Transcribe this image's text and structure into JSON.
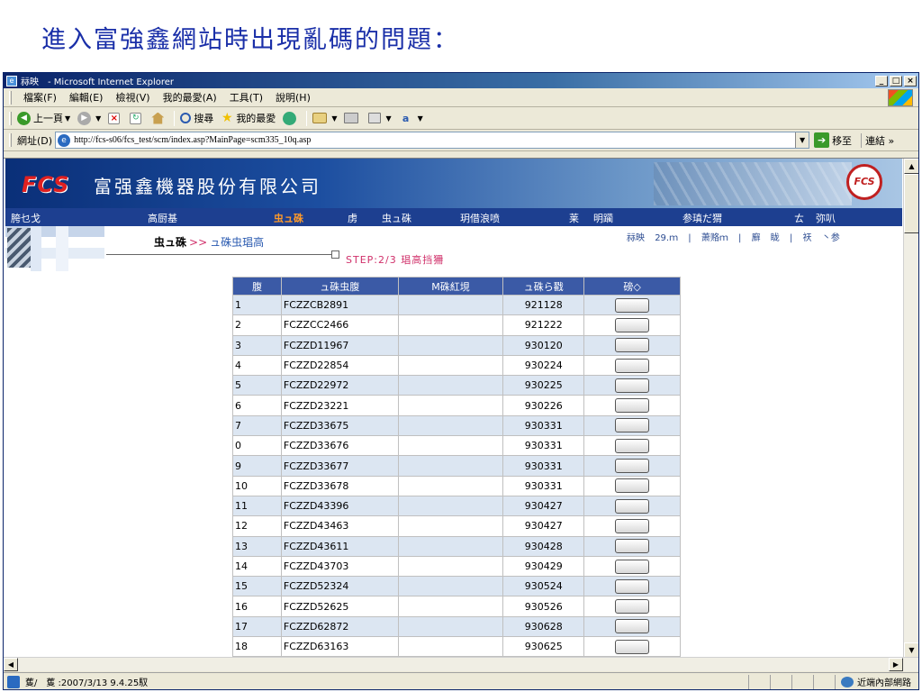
{
  "slide": {
    "title": "進入富強鑫網站時出現亂碼的問題："
  },
  "window": {
    "title": "祘映　- Microsoft Internet Explorer",
    "buttons": {
      "minimize": "_",
      "maximize": "□",
      "close": "×"
    }
  },
  "menu": {
    "items": [
      "檔案(F)",
      "編輯(E)",
      "檢視(V)",
      "我的最愛(A)",
      "工具(T)",
      "說明(H)"
    ]
  },
  "toolbar": {
    "back": "上一頁",
    "search": "搜尋",
    "favorites": "我的最愛"
  },
  "address": {
    "label": "網址(D)",
    "url": "http://fcs-s06/fcs_test/scm/index.asp?MainPage=scm335_10q.asp",
    "go": "移至",
    "links": "連結 »"
  },
  "site": {
    "logo": "FCS",
    "company": "富强鑫機器股份有限公司",
    "emblem": "FCS",
    "nav": [
      {
        "label": "胯乜戈",
        "active": false
      },
      {
        "label": "高厨基",
        "active": false
      },
      {
        "label": "虫ュ硃",
        "active": true
      },
      {
        "label": "虏",
        "active": false
      },
      {
        "label": "虫ュ硃",
        "active": false
      },
      {
        "label": "玥借浪喷",
        "active": false
      },
      {
        "label": "莱",
        "active": false
      },
      {
        "label": "明躏",
        "active": false
      },
      {
        "label": "参瑱だ猬",
        "active": false
      },
      {
        "label": "ㄊ",
        "active": false
      },
      {
        "label": "弥叭",
        "active": false
      }
    ],
    "breadcrumb": {
      "parent": "虫ュ硃",
      "sep": ">>",
      "current": "ュ硃虫琩高"
    },
    "step": "STEP:2/3 琩高挡狦",
    "toplinks": [
      "祘映",
      "29.ｍ",
      "|",
      "萧赂ｍ",
      "|",
      "廯",
      "眬",
      "|",
      "祆",
      "丶参"
    ]
  },
  "table": {
    "headers": [
      "腹",
      "ュ硃虫腹",
      "M硃紅垷",
      "ュ硃ら戳",
      "磅◇"
    ],
    "rows": [
      [
        "1",
        "FCZZCB2891",
        "",
        "921128"
      ],
      [
        "2",
        "FCZZCC2466",
        "",
        "921222"
      ],
      [
        "3",
        "FCZZD11967",
        "",
        "930120"
      ],
      [
        "4",
        "FCZZD22854",
        "",
        "930224"
      ],
      [
        "5",
        "FCZZD22972",
        "",
        "930225"
      ],
      [
        "6",
        "FCZZD23221",
        "",
        "930226"
      ],
      [
        "7",
        "FCZZD33675",
        "",
        "930331"
      ],
      [
        "0",
        "FCZZD33676",
        "",
        "930331"
      ],
      [
        "9",
        "FCZZD33677",
        "",
        "930331"
      ],
      [
        "10",
        "FCZZD33678",
        "",
        "930331"
      ],
      [
        "11",
        "FCZZD43396",
        "",
        "930427"
      ],
      [
        "12",
        "FCZZD43463",
        "",
        "930427"
      ],
      [
        "13",
        "FCZZD43611",
        "",
        "930428"
      ],
      [
        "14",
        "FCZZD43703",
        "",
        "930429"
      ],
      [
        "15",
        "FCZZD52324",
        "",
        "930524"
      ],
      [
        "16",
        "FCZZD52625",
        "",
        "930526"
      ],
      [
        "17",
        "FCZZD62872",
        "",
        "930628"
      ],
      [
        "18",
        "FCZZD63163",
        "",
        "930625"
      ]
    ]
  },
  "status": {
    "text": "蒦/　蒦 :2007/3/13 9.4.25馭",
    "zone": "近端內部網路"
  },
  "colors": {
    "title": "#1a2fa8",
    "nav_bg": "#1d3f90",
    "nav_active": "#ff9a2a",
    "header_bg": "#3b5aa6",
    "row_alt": "#dce6f2",
    "accent": "#d0306a"
  }
}
